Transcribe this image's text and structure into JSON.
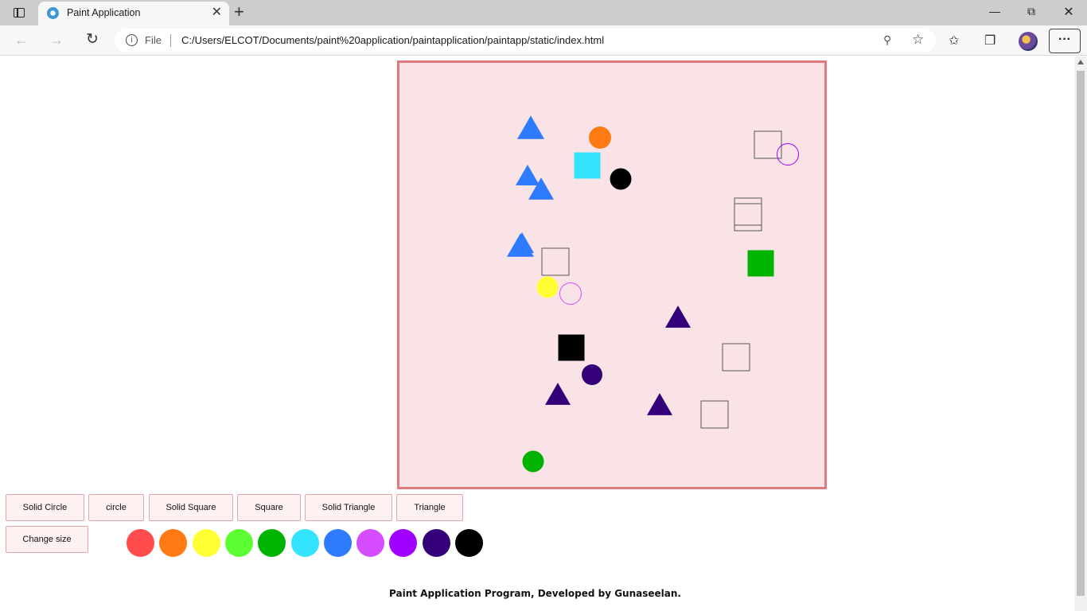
{
  "browser": {
    "tab_title": "Paint Application",
    "tab_close": "✕",
    "new_tab": "+",
    "file_label": "File",
    "url": "C:/Users/ELCOT/Documents/paint%20application/paintapplication/paintapp/static/index.html",
    "more_label": "···"
  },
  "toolbar": {
    "solid_circle": "Solid Circle",
    "circle": "circle",
    "solid_square": "Solid Square",
    "square": "Square",
    "solid_triangle": "Solid Triangle",
    "triangle": "Triangle",
    "change_size": "Change size"
  },
  "palette": [
    "#ff4c4c",
    "#ff7a12",
    "#ffff33",
    "#5cff33",
    "#00b300",
    "#33e4ff",
    "#2e7bff",
    "#d64cff",
    "#a000ff",
    "#34007a",
    "#000000"
  ],
  "canvas": {
    "background": "#f9e3e6",
    "border": "#e07a80",
    "shapes": [
      {
        "kind": "triangle",
        "solid": true,
        "color": "#2e7bff"
      },
      {
        "kind": "circle",
        "solid": true,
        "color": "#ff7a12"
      },
      {
        "kind": "square",
        "solid": false,
        "color": "#555555"
      },
      {
        "kind": "circle",
        "solid": false,
        "color": "#a000ff"
      },
      {
        "kind": "square",
        "solid": true,
        "color": "#33e4ff"
      },
      {
        "kind": "triangle",
        "solid": true,
        "color": "#2e7bff"
      },
      {
        "kind": "triangle",
        "solid": true,
        "color": "#2e7bff"
      },
      {
        "kind": "circle",
        "solid": true,
        "color": "#000000"
      },
      {
        "kind": "square",
        "solid": false,
        "color": "#555555"
      },
      {
        "kind": "square",
        "solid": false,
        "color": "#555555"
      },
      {
        "kind": "triangle",
        "solid": true,
        "color": "#2e7bff"
      },
      {
        "kind": "triangle",
        "solid": true,
        "color": "#2e7bff"
      },
      {
        "kind": "square",
        "solid": false,
        "color": "#555555"
      },
      {
        "kind": "square",
        "solid": true,
        "color": "#00b300"
      },
      {
        "kind": "circle",
        "solid": true,
        "color": "#ffff33"
      },
      {
        "kind": "circle",
        "solid": false,
        "color": "#d64cff"
      },
      {
        "kind": "triangle",
        "solid": true,
        "color": "#34007a"
      },
      {
        "kind": "square",
        "solid": true,
        "color": "#000000"
      },
      {
        "kind": "square",
        "solid": false,
        "color": "#555555"
      },
      {
        "kind": "circle",
        "solid": true,
        "color": "#34007a"
      },
      {
        "kind": "triangle",
        "solid": true,
        "color": "#34007a"
      },
      {
        "kind": "triangle",
        "solid": true,
        "color": "#34007a"
      },
      {
        "kind": "square",
        "solid": false,
        "color": "#555555"
      },
      {
        "kind": "circle",
        "solid": true,
        "color": "#00b300"
      }
    ]
  },
  "footer": "Paint Application Program, Developed by Gunaseelan."
}
